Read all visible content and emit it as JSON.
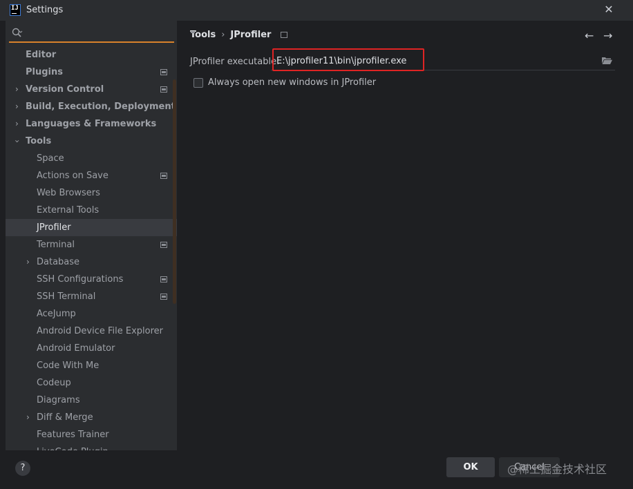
{
  "window": {
    "title": "Settings",
    "app_icon_text": "IJ"
  },
  "sidebar": {
    "search_placeholder": "",
    "items": [
      {
        "label": "Editor",
        "level": 0,
        "expander": "none",
        "project_icon": false
      },
      {
        "label": "Plugins",
        "level": 0,
        "expander": "none",
        "project_icon": true
      },
      {
        "label": "Version Control",
        "level": 0,
        "expander": "collapsed",
        "project_icon": true
      },
      {
        "label": "Build, Execution, Deployment",
        "level": 0,
        "expander": "collapsed",
        "project_icon": false
      },
      {
        "label": "Languages & Frameworks",
        "level": 0,
        "expander": "collapsed",
        "project_icon": false
      },
      {
        "label": "Tools",
        "level": 0,
        "expander": "expanded",
        "project_icon": false
      },
      {
        "label": "Space",
        "level": 1,
        "expander": "none",
        "project_icon": false
      },
      {
        "label": "Actions on Save",
        "level": 1,
        "expander": "none",
        "project_icon": true
      },
      {
        "label": "Web Browsers",
        "level": 1,
        "expander": "none",
        "project_icon": false
      },
      {
        "label": "External Tools",
        "level": 1,
        "expander": "none",
        "project_icon": false
      },
      {
        "label": "JProfiler",
        "level": 1,
        "expander": "none",
        "project_icon": false,
        "selected": true
      },
      {
        "label": "Terminal",
        "level": 1,
        "expander": "none",
        "project_icon": true
      },
      {
        "label": "Database",
        "level": 1,
        "expander": "collapsed",
        "project_icon": false
      },
      {
        "label": "SSH Configurations",
        "level": 1,
        "expander": "none",
        "project_icon": true
      },
      {
        "label": "SSH Terminal",
        "level": 1,
        "expander": "none",
        "project_icon": true
      },
      {
        "label": "AceJump",
        "level": 1,
        "expander": "none",
        "project_icon": false
      },
      {
        "label": "Android Device File Explorer",
        "level": 1,
        "expander": "none",
        "project_icon": false
      },
      {
        "label": "Android Emulator",
        "level": 1,
        "expander": "none",
        "project_icon": false
      },
      {
        "label": "Code With Me",
        "level": 1,
        "expander": "none",
        "project_icon": false
      },
      {
        "label": "Codeup",
        "level": 1,
        "expander": "none",
        "project_icon": false
      },
      {
        "label": "Diagrams",
        "level": 1,
        "expander": "none",
        "project_icon": false
      },
      {
        "label": "Diff & Merge",
        "level": 1,
        "expander": "collapsed",
        "project_icon": false
      },
      {
        "label": "Features Trainer",
        "level": 1,
        "expander": "none",
        "project_icon": false
      },
      {
        "label": "LiveCode Plugin",
        "level": 1,
        "expander": "none",
        "project_icon": false
      }
    ]
  },
  "breadcrumb": {
    "parent": "Tools",
    "separator": "›",
    "current": "JProfiler"
  },
  "settings": {
    "executable_label": "JProfiler executable:",
    "executable_value": "E:\\jprofiler11\\bin\\jprofiler.exe",
    "checkbox_label": "Always open new windows in JProfiler",
    "checkbox_checked": false
  },
  "footer": {
    "help": "?",
    "ok_label": "OK",
    "cancel_label": "Cancel",
    "watermark": "@稀土掘金技术社区"
  },
  "colors": {
    "accent": "#d9822b",
    "highlight_box": "#e02424",
    "selection": "#393b40"
  }
}
